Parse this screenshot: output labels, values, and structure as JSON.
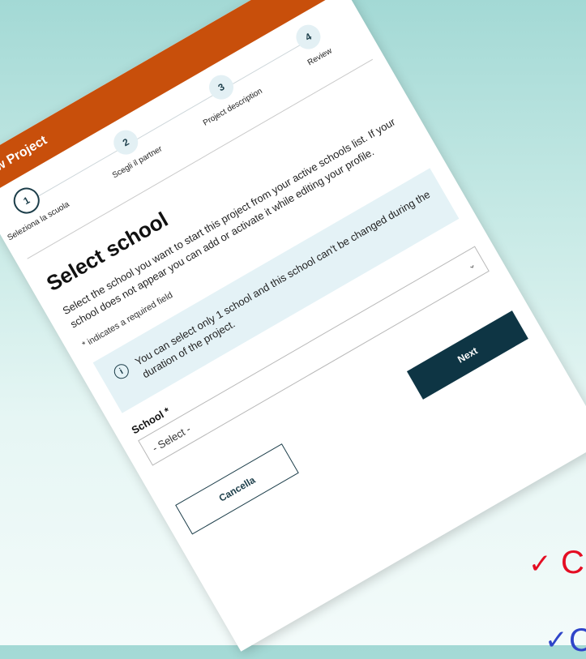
{
  "header": {
    "title": "New Project"
  },
  "steps": [
    {
      "number": "1",
      "label": "Seleziona la scuola"
    },
    {
      "number": "2",
      "label": "Scegli il partner"
    },
    {
      "number": "3",
      "label": "Project description"
    },
    {
      "number": "4",
      "label": "Review"
    }
  ],
  "main": {
    "title": "Select school",
    "description": "Select the school you want to start this project from your active schools list. If your school does not appear you can add or activate it while editing your profile.",
    "required_note": "* indicates a required field",
    "info_text": "You can select only 1 school and this school can't be changed during the duration of the project.",
    "info_icon": "i",
    "field_label": "School *",
    "select_value": "- Select -",
    "chevron": "⌄"
  },
  "buttons": {
    "cancel": "Cancella",
    "next": "Next"
  },
  "overlay": {
    "check_red": "✓",
    "letter_red": "C",
    "check_blue": "✓",
    "letter_blue": "C"
  },
  "colors": {
    "header": "#c84f0b",
    "accent": "#0e3544",
    "info_bg": "#e4f2f6",
    "check_red": "#e40d23",
    "check_blue": "#2f45c9"
  }
}
